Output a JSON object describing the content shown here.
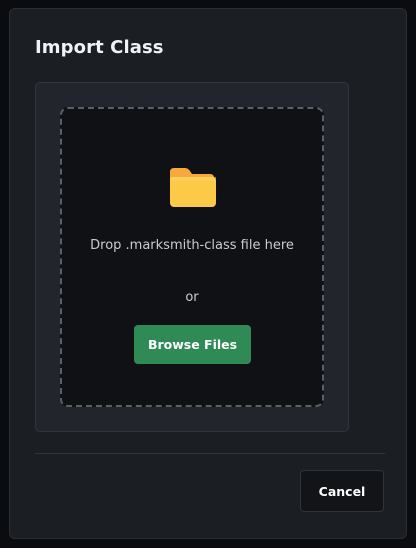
{
  "dialog": {
    "title": "Import Class"
  },
  "dropzone": {
    "icon": "folder-icon",
    "instruction": "Drop .marksmith-class file here",
    "or_label": "or",
    "browse_label": "Browse Files"
  },
  "footer": {
    "cancel_label": "Cancel"
  },
  "colors": {
    "accent": "#2f8a56",
    "folder": "#fdc948",
    "folder_back": "#f7a93b"
  }
}
